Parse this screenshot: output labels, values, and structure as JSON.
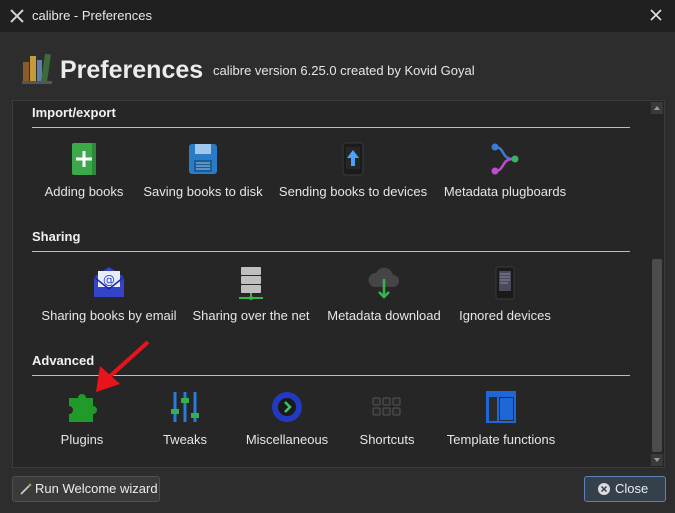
{
  "window": {
    "title": "calibre - Preferences",
    "close_icon": "close-icon"
  },
  "header": {
    "title": "Preferences",
    "subtitle": "calibre version 6.25.0 created by Kovid Goyal"
  },
  "sections": [
    {
      "title": "Import/export",
      "items": [
        {
          "label": "Adding books",
          "icon": "add-book-icon"
        },
        {
          "label": "Saving books to disk",
          "icon": "floppy-disk-icon"
        },
        {
          "label": "Sending books to devices",
          "icon": "device-upload-icon"
        },
        {
          "label": "Metadata plugboards",
          "icon": "plugboard-icon"
        }
      ]
    },
    {
      "title": "Sharing",
      "items": [
        {
          "label": "Sharing books by email",
          "icon": "email-icon"
        },
        {
          "label": "Sharing over the net",
          "icon": "server-icon"
        },
        {
          "label": "Metadata download",
          "icon": "cloud-download-icon"
        },
        {
          "label": "Ignored devices",
          "icon": "ereader-icon"
        }
      ]
    },
    {
      "title": "Advanced",
      "items": [
        {
          "label": "Plugins",
          "icon": "puzzle-piece-icon"
        },
        {
          "label": "Tweaks",
          "icon": "sliders-icon"
        },
        {
          "label": "Miscellaneous",
          "icon": "chevron-circle-icon"
        },
        {
          "label": "Shortcuts",
          "icon": "keyboard-icon"
        },
        {
          "label": "Template functions",
          "icon": "template-icon"
        }
      ]
    }
  ],
  "buttons": {
    "wizard": "Run Welcome wizard",
    "close": "Close"
  },
  "colors": {
    "accent": "#5b84b5",
    "annotation_arrow": "#e8141b"
  }
}
